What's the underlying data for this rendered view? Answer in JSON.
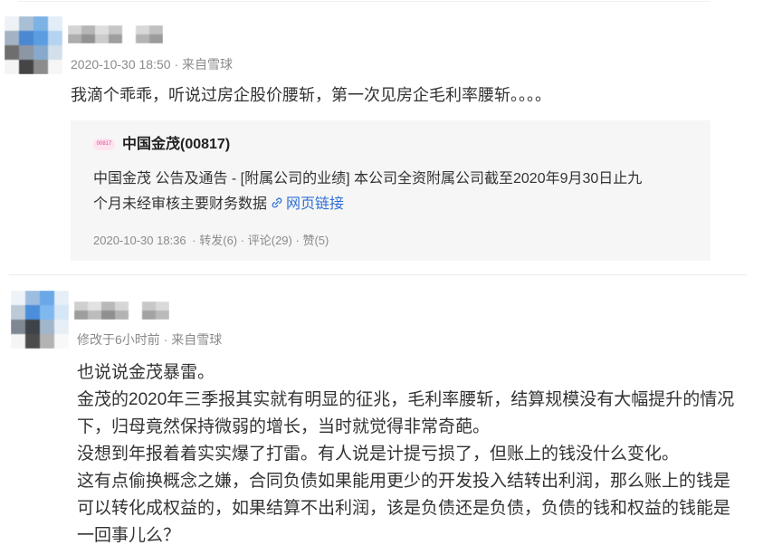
{
  "colors": {
    "text": "#333333",
    "title": "#222222",
    "meta": "#8a8a8a",
    "link": "#2f6fd6",
    "card_background": "#f6f6f6",
    "badge_text": "#e0468f",
    "badge_background": "#fde4ef",
    "divider": "#ebebeb"
  },
  "icons": {
    "stock_badge": "stock-badge-icon",
    "web_link": "link-icon"
  },
  "posts": [
    {
      "meta": {
        "time": "2020-10-30 18:50",
        "separator": "·",
        "source": "来自雪球"
      },
      "body_lines": [
        "我滴个乖乖，听说过房企股价腰斩，第一次见房企毛利率腰斩。。。。"
      ],
      "quote": {
        "badge_label": "00817",
        "title": "中国金茂(00817)",
        "text_lines": [
          "中国金茂 公告及通告 - [附属公司的业绩] 本公司全资附属公司截至2020年9月30日止九",
          "个月未经审核主要财务数据"
        ],
        "link_label": "网页链接",
        "footer": {
          "time": "2020-10-30 18:36",
          "separator": "·",
          "retweets": "转发(6)",
          "comments": "评论(29)",
          "likes": "赞(5)"
        }
      }
    },
    {
      "meta": {
        "time": "修改于6小时前",
        "separator": "·",
        "source": "来自雪球"
      },
      "body_lines": [
        "也说说金茂暴雷。",
        "金茂的2020年三季报其实就有明显的征兆，毛利率腰斩，结算规模没有大幅提升的情况",
        "下，归母竟然保持微弱的增长，当时就觉得非常奇葩。",
        "没想到年报着着实实爆了打雷。有人说是计提亏损了，但账上的钱没什么变化。",
        "这有点偷换概念之嫌，合同负债如果能用更少的开发投入结转出利润，那么账上的钱是",
        "可以转化成权益的，如果结算不出利润，该是负债还是负债，负债的钱和权益的钱能是",
        "一回事儿么？"
      ]
    }
  ]
}
